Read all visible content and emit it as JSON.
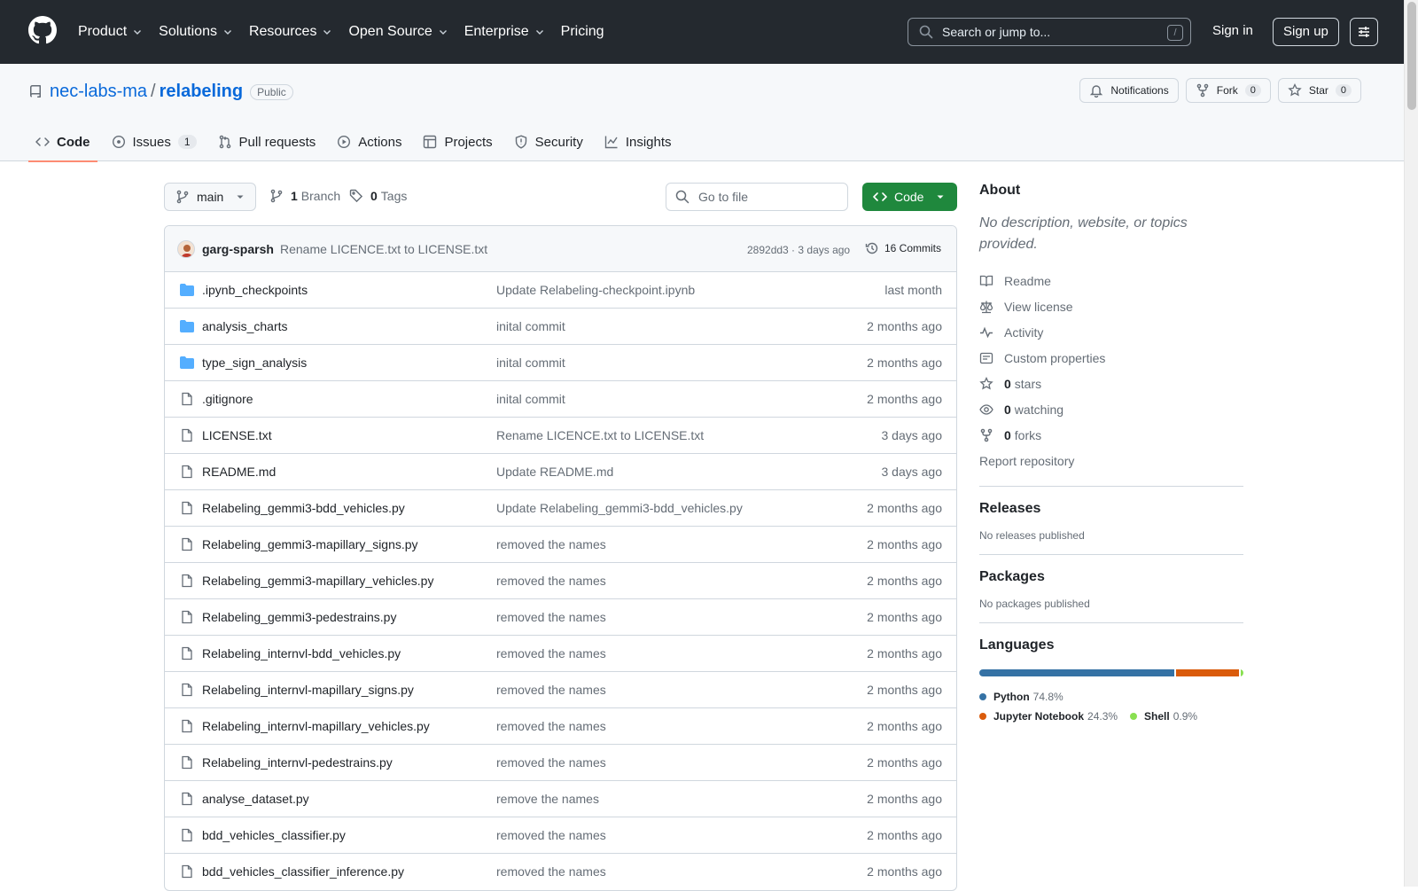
{
  "topnav": {
    "items": [
      {
        "label": "Product",
        "has_menu": true
      },
      {
        "label": "Solutions",
        "has_menu": true
      },
      {
        "label": "Resources",
        "has_menu": true
      },
      {
        "label": "Open Source",
        "has_menu": true
      },
      {
        "label": "Enterprise",
        "has_menu": true
      },
      {
        "label": "Pricing",
        "has_menu": false
      }
    ],
    "search_placeholder": "Search or jump to...",
    "search_shortcut": "/",
    "signin": "Sign in",
    "signup": "Sign up"
  },
  "repo": {
    "owner": "nec-labs-ma",
    "separator": "/",
    "name": "relabeling",
    "visibility": "Public",
    "notifications_label": "Notifications",
    "fork_label": "Fork",
    "fork_count": "0",
    "star_label": "Star",
    "star_count": "0"
  },
  "tabs": [
    {
      "label": "Code",
      "icon": "code-icon",
      "active": true
    },
    {
      "label": "Issues",
      "icon": "issue-icon",
      "count": "1"
    },
    {
      "label": "Pull requests",
      "icon": "pull-request-icon"
    },
    {
      "label": "Actions",
      "icon": "play-icon"
    },
    {
      "label": "Projects",
      "icon": "table-icon"
    },
    {
      "label": "Security",
      "icon": "shield-icon"
    },
    {
      "label": "Insights",
      "icon": "graph-icon"
    }
  ],
  "toolbar": {
    "branch": "main",
    "branch_count": "1",
    "branch_label": "Branch",
    "tag_count": "0",
    "tag_label": "Tags",
    "goto_placeholder": "Go to file",
    "code_button": "Code"
  },
  "commit": {
    "author": "garg-sparsh",
    "message": "Rename LICENCE.txt to LICENSE.txt",
    "sha_time": "2892dd3 · 3 days ago",
    "commits_label": "16 Commits"
  },
  "files": [
    {
      "type": "folder",
      "name": ".ipynb_checkpoints",
      "message": "Update Relabeling-checkpoint.ipynb",
      "date": "last month"
    },
    {
      "type": "folder",
      "name": "analysis_charts",
      "message": "inital commit",
      "date": "2 months ago"
    },
    {
      "type": "folder",
      "name": "type_sign_analysis",
      "message": "inital commit",
      "date": "2 months ago"
    },
    {
      "type": "file",
      "name": ".gitignore",
      "message": "inital commit",
      "date": "2 months ago"
    },
    {
      "type": "file",
      "name": "LICENSE.txt",
      "message": "Rename LICENCE.txt to LICENSE.txt",
      "date": "3 days ago"
    },
    {
      "type": "file",
      "name": "README.md",
      "message": "Update README.md",
      "date": "3 days ago"
    },
    {
      "type": "file",
      "name": "Relabeling_gemmi3-bdd_vehicles.py",
      "message": "Update Relabeling_gemmi3-bdd_vehicles.py",
      "date": "2 months ago"
    },
    {
      "type": "file",
      "name": "Relabeling_gemmi3-mapillary_signs.py",
      "message": "removed the names",
      "date": "2 months ago"
    },
    {
      "type": "file",
      "name": "Relabeling_gemmi3-mapillary_vehicles.py",
      "message": "removed the names",
      "date": "2 months ago"
    },
    {
      "type": "file",
      "name": "Relabeling_gemmi3-pedestrains.py",
      "message": "removed the names",
      "date": "2 months ago"
    },
    {
      "type": "file",
      "name": "Relabeling_internvl-bdd_vehicles.py",
      "message": "removed the names",
      "date": "2 months ago"
    },
    {
      "type": "file",
      "name": "Relabeling_internvl-mapillary_signs.py",
      "message": "removed the names",
      "date": "2 months ago"
    },
    {
      "type": "file",
      "name": "Relabeling_internvl-mapillary_vehicles.py",
      "message": "removed the names",
      "date": "2 months ago"
    },
    {
      "type": "file",
      "name": "Relabeling_internvl-pedestrains.py",
      "message": "removed the names",
      "date": "2 months ago"
    },
    {
      "type": "file",
      "name": "analyse_dataset.py",
      "message": "remove the names",
      "date": "2 months ago"
    },
    {
      "type": "file",
      "name": "bdd_vehicles_classifier.py",
      "message": "removed the names",
      "date": "2 months ago"
    },
    {
      "type": "file",
      "name": "bdd_vehicles_classifier_inference.py",
      "message": "removed the names",
      "date": "2 months ago"
    }
  ],
  "about": {
    "title": "About",
    "description": "No description, website, or topics provided.",
    "links": [
      {
        "icon": "book-icon",
        "label": "Readme"
      },
      {
        "icon": "law-icon",
        "label": "View license"
      },
      {
        "icon": "pulse-icon",
        "label": "Activity"
      },
      {
        "icon": "note-icon",
        "label": "Custom properties"
      },
      {
        "icon": "star-icon",
        "count": "0",
        "label": "stars"
      },
      {
        "icon": "eye-icon",
        "count": "0",
        "label": "watching"
      },
      {
        "icon": "fork-icon",
        "count": "0",
        "label": "forks"
      }
    ],
    "report": "Report repository"
  },
  "releases": {
    "title": "Releases",
    "empty": "No releases published"
  },
  "packages": {
    "title": "Packages",
    "empty": "No packages published"
  },
  "languages": {
    "title": "Languages",
    "items": [
      {
        "name": "Python",
        "percent": "74.8%",
        "value": 74.8,
        "color": "#3572A5"
      },
      {
        "name": "Jupyter Notebook",
        "percent": "24.3%",
        "value": 24.3,
        "color": "#DA5B0B"
      },
      {
        "name": "Shell",
        "percent": "0.9%",
        "value": 0.9,
        "color": "#89e051"
      }
    ]
  }
}
